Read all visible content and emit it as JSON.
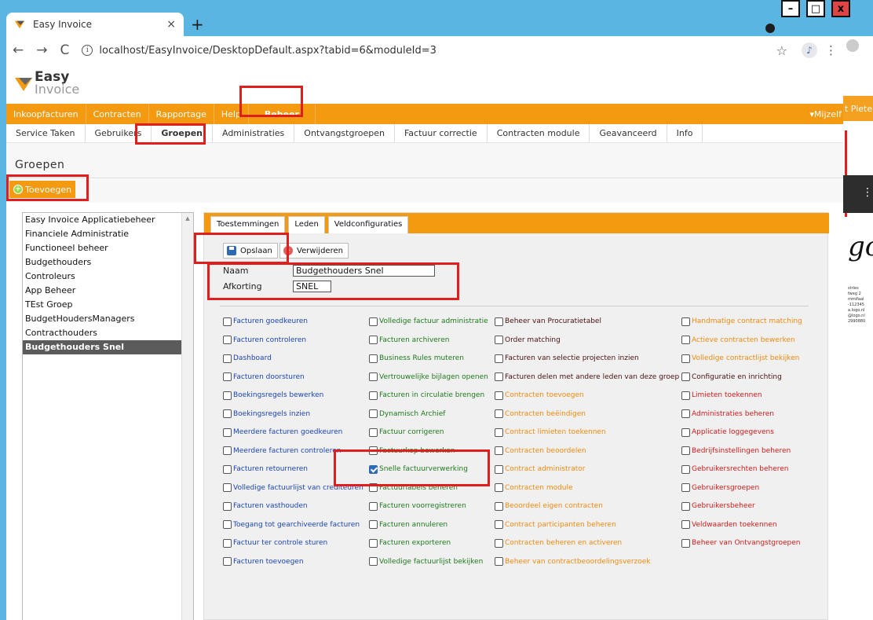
{
  "browser": {
    "tab_title": "Easy Invoice",
    "tab_close": "×",
    "new_tab": "+",
    "back": "←",
    "forward": "→",
    "reload": "C",
    "url": "localhost/EasyInvoice/DesktopDefault.aspx?tabid=6&moduleId=3"
  },
  "logo": {
    "line1": "Easy",
    "line2": "Invoice"
  },
  "main_nav": {
    "items": [
      "Inkoopfacturen",
      "Contracten",
      "Rapportage",
      "Help"
    ],
    "active": "Beheer",
    "user_menu": "▾Mijzelf"
  },
  "sub_nav": {
    "items": [
      "Service Taken",
      "Gebruikers",
      "Groepen",
      "Administraties",
      "Ontvangstgroepen",
      "Factuur correctie",
      "Contracten module",
      "Geavanceerd",
      "Info"
    ],
    "active": "Groepen"
  },
  "page_title": "Groepen",
  "add_button": "Toevoegen",
  "groups": {
    "items": [
      "Easy Invoice Applicatiebeheer",
      "Financiele Administratie",
      "Functioneel beheer",
      "Budgethouders",
      "Controleurs",
      "App Beheer",
      "TEst Groep",
      "BudgetHoudersManagers",
      "Contracthouders",
      "Budgethouders Snel"
    ],
    "selected": "Budgethouders Snel"
  },
  "panel_tabs": [
    "Toestemmingen",
    "Leden",
    "Veldconfiguraties"
  ],
  "actions": {
    "save": "Opslaan",
    "delete": "Verwijderen"
  },
  "form": {
    "name_label": "Naam",
    "name_value": "Budgethouders Snel",
    "abbr_label": "Afkorting",
    "abbr_value": "SNEL"
  },
  "permissions": {
    "col1": [
      {
        "label": "Facturen goedkeuren",
        "color": "blue",
        "checked": false
      },
      {
        "label": "Facturen controleren",
        "color": "blue",
        "checked": false
      },
      {
        "label": "Dashboard",
        "color": "blue",
        "checked": false
      },
      {
        "label": "Facturen doorsturen",
        "color": "blue",
        "checked": false
      },
      {
        "label": "Boekingsregels bewerken",
        "color": "blue",
        "checked": false
      },
      {
        "label": "Boekingsregels inzien",
        "color": "blue",
        "checked": false
      },
      {
        "label": "Meerdere facturen goedkeuren",
        "color": "blue",
        "checked": false
      },
      {
        "label": "Meerdere facturen controleren",
        "color": "blue",
        "checked": false
      },
      {
        "label": "Facturen retourneren",
        "color": "blue",
        "checked": false
      },
      {
        "label": "Volledige factuurlijst van crediteuren",
        "color": "blue",
        "checked": false
      },
      {
        "label": "Facturen vasthouden",
        "color": "blue",
        "checked": false
      },
      {
        "label": "Toegang tot gearchiveerde facturen",
        "color": "blue",
        "checked": false
      },
      {
        "label": "Factuur ter controle sturen",
        "color": "blue",
        "checked": false
      },
      {
        "label": "Facturen toevoegen",
        "color": "blue",
        "checked": false
      }
    ],
    "col2": [
      {
        "label": "Volledige factuur administratie",
        "color": "green",
        "checked": false
      },
      {
        "label": "Facturen archiveren",
        "color": "green",
        "checked": false
      },
      {
        "label": "Business Rules muteren",
        "color": "green",
        "checked": false
      },
      {
        "label": "Vertrouwelijke bijlagen openen",
        "color": "green",
        "checked": false
      },
      {
        "label": "Facturen in circulatie brengen",
        "color": "green",
        "checked": false
      },
      {
        "label": "Dynamisch Archief",
        "color": "green",
        "checked": false
      },
      {
        "label": "Factuur corrigeren",
        "color": "green",
        "checked": false
      },
      {
        "label": "Factuurkop bewerken",
        "color": "green",
        "checked": false
      },
      {
        "label": "Snelle factuurverwerking",
        "color": "green",
        "checked": true
      },
      {
        "label": "Factuurlabels beheren",
        "color": "green",
        "checked": false
      },
      {
        "label": "Facturen voorregistreren",
        "color": "green",
        "checked": false
      },
      {
        "label": "Facturen annuleren",
        "color": "green",
        "checked": false
      },
      {
        "label": "Facturen exporteren",
        "color": "green",
        "checked": false
      },
      {
        "label": "Volledige factuurlijst bekijken",
        "color": "green",
        "checked": false
      }
    ],
    "col3": [
      {
        "label": "Beheer van Procuratietabel",
        "color": "dark",
        "checked": false
      },
      {
        "label": "Order matching",
        "color": "dark",
        "checked": false
      },
      {
        "label": "Facturen van selectie projecten inzien",
        "color": "dark",
        "checked": false
      },
      {
        "label": "Facturen delen met andere leden van deze groep",
        "color": "dark",
        "checked": false
      },
      {
        "label": "Contracten toevoegen",
        "color": "orange",
        "checked": false
      },
      {
        "label": "Contracten beëindigen",
        "color": "orange",
        "checked": false
      },
      {
        "label": "Contract limieten toekennen",
        "color": "orange",
        "checked": false
      },
      {
        "label": "Contracten beoordelen",
        "color": "orange",
        "checked": false
      },
      {
        "label": "Contract administrator",
        "color": "orange",
        "checked": false
      },
      {
        "label": "Contracten module",
        "color": "orange",
        "checked": false
      },
      {
        "label": "Beoordeel eigen contracten",
        "color": "orange",
        "checked": false
      },
      {
        "label": "Contract participanten beheren",
        "color": "orange",
        "checked": false
      },
      {
        "label": "Contracten beheren en activeren",
        "color": "orange",
        "checked": false
      },
      {
        "label": "Beheer van contractbeoordelingsverzoek",
        "color": "orange",
        "checked": false
      }
    ],
    "col4": [
      {
        "label": "Handmatige contract matching",
        "color": "orange",
        "checked": false
      },
      {
        "label": "Actieve contracten bewerken",
        "color": "orange",
        "checked": false
      },
      {
        "label": "Volledige contractlijst bekijken",
        "color": "orange",
        "checked": false
      },
      {
        "label": "Configuratie en inrichting",
        "color": "dark",
        "checked": false
      },
      {
        "label": "Limieten toekennen",
        "color": "red",
        "checked": false
      },
      {
        "label": "Administraties beheren",
        "color": "red",
        "checked": false
      },
      {
        "label": "Applicatie loggegevens",
        "color": "red",
        "checked": false
      },
      {
        "label": "Bedrijfsinstellingen beheren",
        "color": "red",
        "checked": false
      },
      {
        "label": "Gebruikersrechten beheren",
        "color": "red",
        "checked": false
      },
      {
        "label": "Gebruikersgroepen",
        "color": "red",
        "checked": false
      },
      {
        "label": "Gebruikersbeheer",
        "color": "red",
        "checked": false
      },
      {
        "label": "Veldwaarden toekennen",
        "color": "red",
        "checked": false
      },
      {
        "label": "Beheer van Ontvangstgroepen",
        "color": "red",
        "checked": false
      }
    ]
  },
  "right_pane": {
    "pieter": "t Pieter",
    "logo": "go",
    "text_lines": [
      "stries",
      "fweg 2",
      "mmifaal",
      "",
      "-112345",
      "a.logo.nl",
      "@logo.nl",
      "2990880"
    ]
  },
  "colors": {
    "accent": "#f39a10",
    "annotation": "#e01e1e",
    "checkbox_checked": "#2f6ab5"
  }
}
